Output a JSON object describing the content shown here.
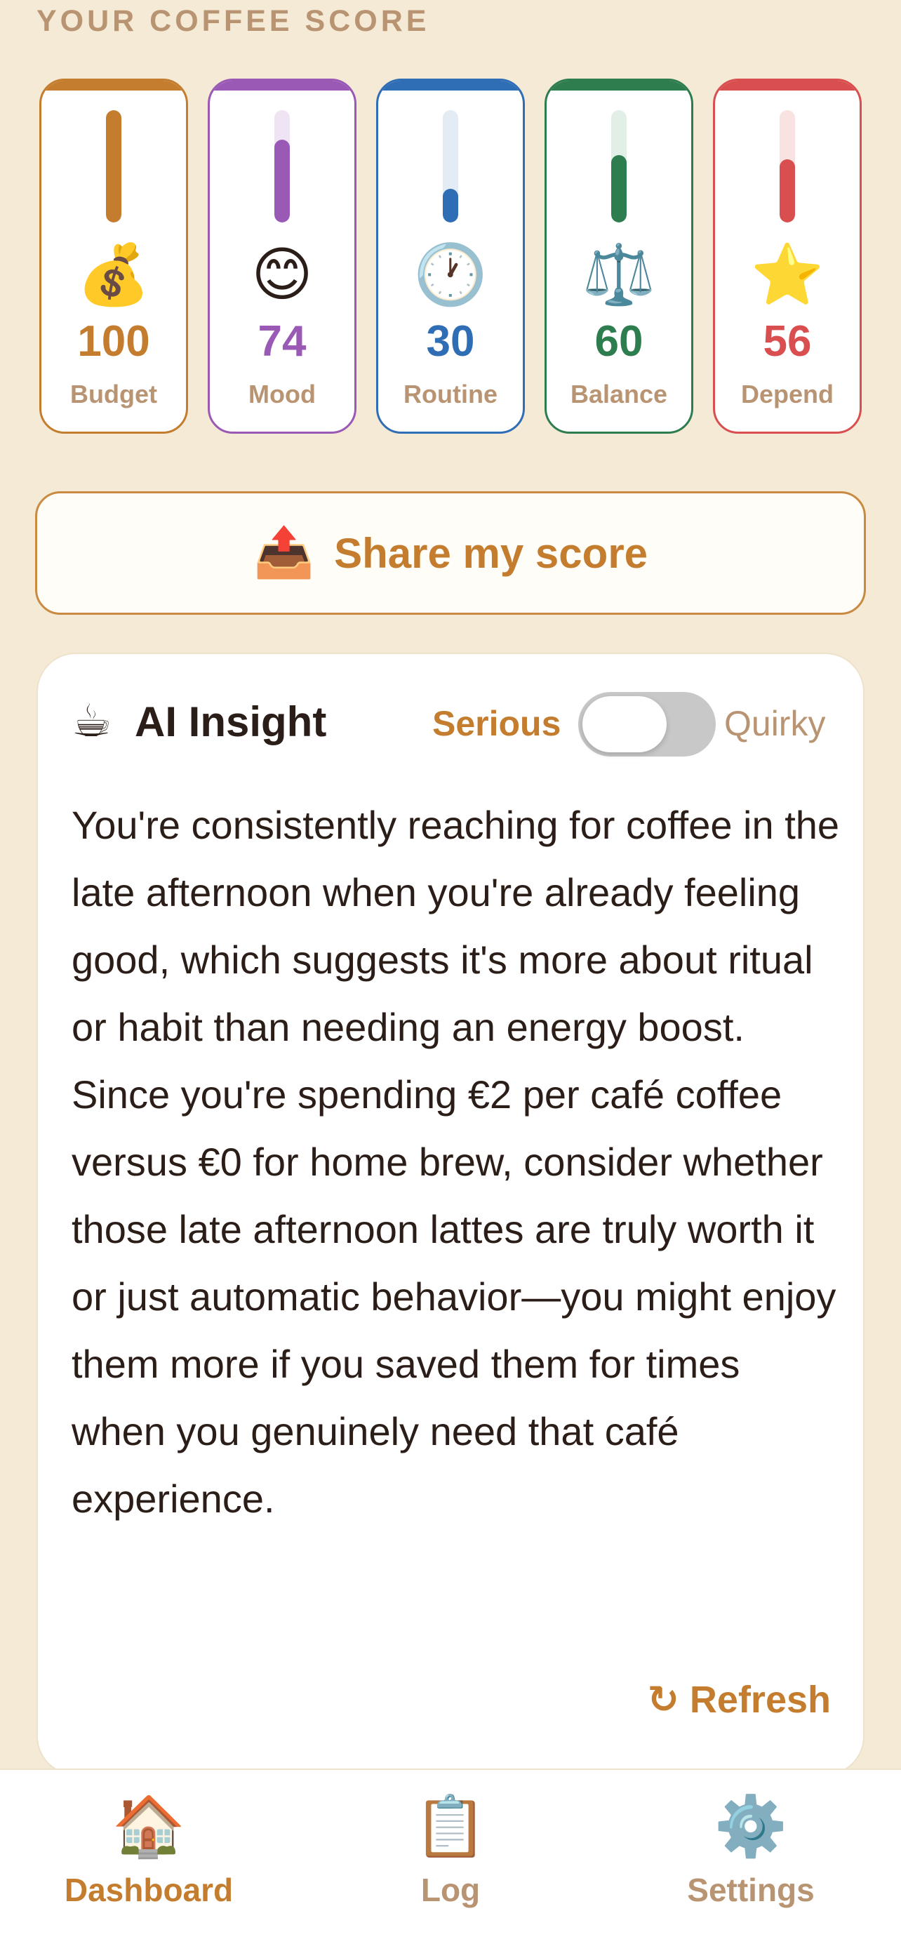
{
  "section_label": "YOUR COFFEE SCORE",
  "scores": [
    {
      "label": "Budget",
      "value": "100",
      "level": 1.0,
      "emoji": "💰",
      "icon": "money-bag-icon",
      "color": "#c47d2e",
      "track": "#f4e6d6"
    },
    {
      "label": "Mood",
      "value": "74",
      "level": 0.74,
      "emoji": "😊",
      "icon": "smile-icon",
      "color": "#9b59b6",
      "track": "#efe4f4"
    },
    {
      "label": "Routine",
      "value": "30",
      "level": 0.3,
      "emoji": "🕐",
      "icon": "clock-icon",
      "color": "#2f6db5",
      "track": "#e3ebf5"
    },
    {
      "label": "Balance",
      "value": "60",
      "level": 0.6,
      "emoji": "⚖️",
      "icon": "scales-icon",
      "color": "#2e7d4f",
      "track": "#e2efe6"
    },
    {
      "label": "Depend",
      "value": "56",
      "level": 0.56,
      "emoji": "⭐",
      "icon": "star-icon",
      "color": "#d94f4f",
      "track": "#f9e2e2"
    }
  ],
  "share": {
    "label": "Share my score",
    "icon": "📤",
    "icon_name": "share-outbox-icon"
  },
  "insight": {
    "icon": "☕",
    "icon_name": "coffee-icon",
    "title": "AI Insight",
    "mode_left": "Serious",
    "mode_right": "Quirky",
    "quirky_enabled": false,
    "body": "You're consistently reaching for coffee in the late afternoon when you're already feeling good, which suggests it's more about ritual or habit than needing an energy boost. Since you're spending €2 per café coffee versus €0 for home brew, consider whether those late afternoon lattes are truly worth it or just automatic behavior—you might enjoy them more if you saved them for times when you genuinely need that café experience.",
    "refresh_icon": "↻",
    "refresh_label": "Refresh"
  },
  "tabs": [
    {
      "label": "Dashboard",
      "icon": "🏠",
      "icon_name": "house-icon",
      "active": true
    },
    {
      "label": "Log",
      "icon": "📋",
      "icon_name": "clipboard-icon",
      "active": false
    },
    {
      "label": "Settings",
      "icon": "⚙️",
      "icon_name": "gear-icon",
      "active": false
    }
  ],
  "colors": {
    "background": "#f4ead6",
    "accent": "#c47d2e",
    "muted_label": "#b89473",
    "text": "#2b1d17"
  }
}
